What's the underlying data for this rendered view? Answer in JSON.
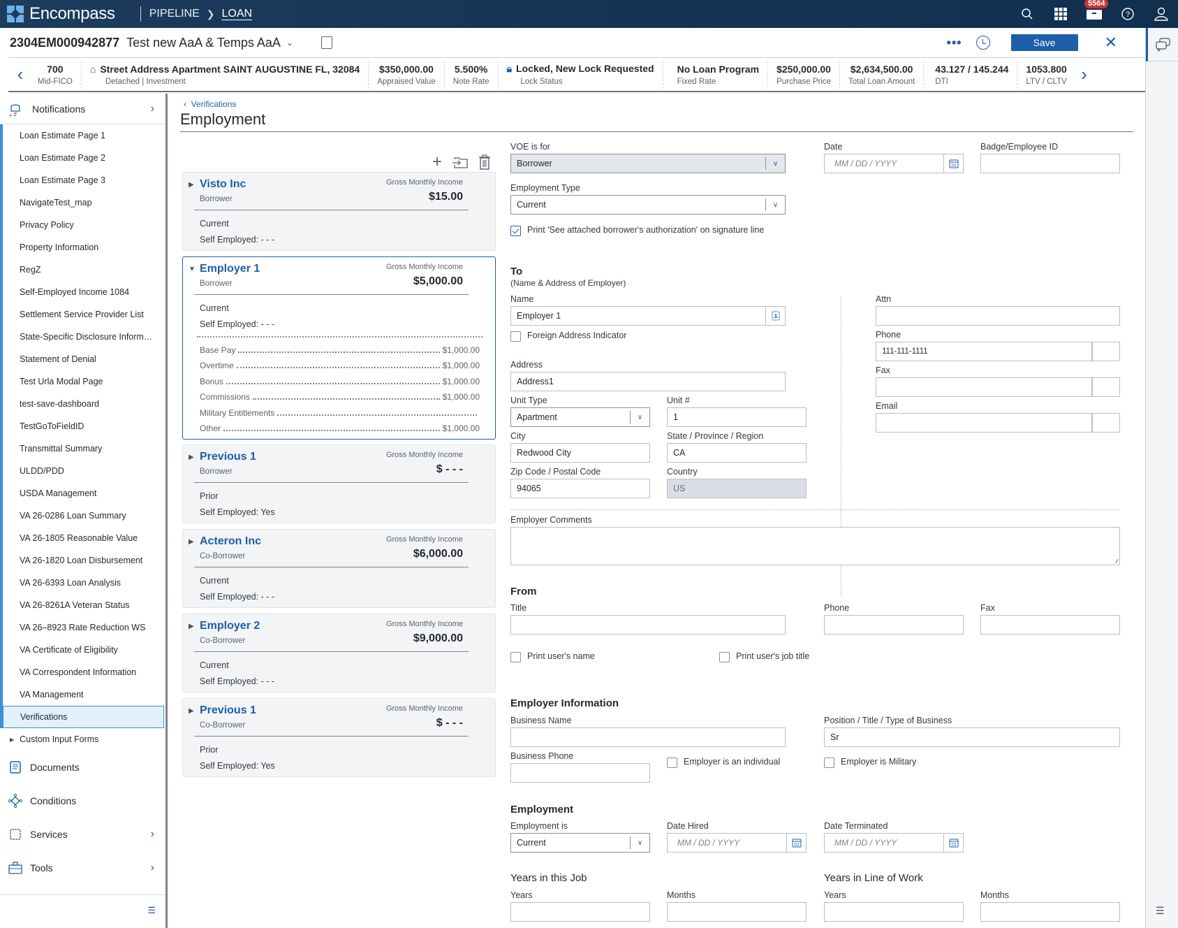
{
  "app": {
    "name": "Encompass",
    "breadcrumb": [
      "PIPELINE",
      "LOAN"
    ],
    "notification_count": "5564",
    "icons": [
      "search-icon",
      "apps-grid-icon",
      "inbox-icon",
      "help-icon",
      "user-icon"
    ]
  },
  "loan": {
    "number": "2304EM000942877",
    "borrower_name": "Test new AaA & Temps AaA",
    "save_label": "Save",
    "more_label": "•••"
  },
  "summary": [
    {
      "value": "700",
      "label": "Mid-FICO"
    },
    {
      "value": "Street Address Apartment SAINT AUGUSTINE FL, 32084",
      "label": "Detached | Investment",
      "icon": "home-icon"
    },
    {
      "value": "$350,000.00",
      "label": "Appraised Value"
    },
    {
      "value": "5.500%",
      "label": "Note Rate"
    },
    {
      "value": "Locked, New Lock Requested",
      "label": "Lock Status",
      "icon": "lock-icon"
    },
    {
      "value": "No Loan Program",
      "label": "Fixed Rate"
    },
    {
      "value": "$250,000.00",
      "label": "Purchase Price"
    },
    {
      "value": "$2,634,500.00",
      "label": "Total Loan Amount"
    },
    {
      "value": "43.127 / 145.244",
      "label": "DTI"
    },
    {
      "value": "1053.800",
      "label": "LTV / CLTV"
    }
  ],
  "sidebar": {
    "notifications": "Notifications",
    "forms": [
      "Loan Estimate Page 1",
      "Loan Estimate Page 2",
      "Loan Estimate Page 3",
      "NavigateTest_map",
      "Privacy Policy",
      "Property Information",
      "RegZ",
      "Self-Employed Income 1084",
      "Settlement Service Provider List",
      "State-Specific Disclosure Inform…",
      "Statement of Denial",
      "Test Urla Modal Page",
      "test-save-dashboard",
      "TestGoToFieldID",
      "Transmittal Summary",
      "ULDD/PDD",
      "USDA Management",
      "VA 26-0286 Loan Summary",
      "VA 26-1805 Reasonable Value",
      "VA 26-1820 Loan Disbursement",
      "VA 26-6393 Loan Analysis",
      "VA 26-8261A Veteran Status",
      "VA 26–8923 Rate Reduction WS",
      "VA Certificate of Eligibility",
      "VA Correspondent Information",
      "VA Management",
      "Verifications"
    ],
    "active_form": "Verifications",
    "custom_forms": "Custom Input Forms",
    "sections": [
      "Documents",
      "Conditions",
      "Services",
      "Tools"
    ]
  },
  "page": {
    "back_label": "Verifications",
    "title": "Employment"
  },
  "employers": [
    {
      "name": "Visto Inc",
      "role": "Borrower",
      "gmi_label": "Gross Monthly Income",
      "gmi": "$15.00",
      "status": "Current",
      "self_employed": "Self Employed: - - -",
      "expanded": false
    },
    {
      "name": "Employer 1",
      "role": "Borrower",
      "gmi_label": "Gross Monthly Income",
      "gmi": "$5,000.00",
      "status": "Current",
      "self_employed": "Self Employed: - - -",
      "expanded": true,
      "income": [
        {
          "label": "Base Pay",
          "value": "$1,000.00"
        },
        {
          "label": "Overtime",
          "value": "$1,000.00"
        },
        {
          "label": "Bonus",
          "value": "$1,000.00"
        },
        {
          "label": "Commissions",
          "value": "$1,000.00"
        },
        {
          "label": "Military Entitlements",
          "value": ""
        },
        {
          "label": "Other",
          "value": "$1,000.00"
        }
      ]
    },
    {
      "name": "Previous 1",
      "role": "Borrower",
      "gmi_label": "Gross Monthly Income",
      "gmi": "$ - - -",
      "status": "Prior",
      "self_employed": "Self Employed: Yes",
      "expanded": false
    },
    {
      "name": "Acteron Inc",
      "role": "Co-Borrower",
      "gmi_label": "Gross Monthly Income",
      "gmi": "$6,000.00",
      "status": "Current",
      "self_employed": "Self Employed: - - -",
      "expanded": false
    },
    {
      "name": "Employer 2",
      "role": "Co-Borrower",
      "gmi_label": "Gross Monthly Income",
      "gmi": "$9,000.00",
      "status": "Current",
      "self_employed": "Self Employed: - - -",
      "expanded": false
    },
    {
      "name": "Previous 1",
      "role": "Co-Borrower",
      "gmi_label": "Gross Monthly Income",
      "gmi": "$ - - -",
      "status": "Prior",
      "self_employed": "Self Employed: Yes",
      "expanded": false
    }
  ],
  "form": {
    "voe_for": {
      "label": "VOE is for",
      "value": "Borrower"
    },
    "date": {
      "label": "Date",
      "placeholder": "MM / DD / YYYY"
    },
    "badge": {
      "label": "Badge/Employee ID",
      "value": ""
    },
    "employment_type": {
      "label": "Employment Type",
      "value": "Current"
    },
    "print_auth": {
      "label": "Print 'See attached borrower's authorization' on signature line",
      "checked": true
    },
    "to": {
      "title": "To",
      "subtitle": "(Name & Address of Employer)",
      "name": {
        "label": "Name",
        "value": "Employer 1"
      },
      "foreign": {
        "label": "Foreign Address Indicator",
        "checked": false
      },
      "address": {
        "label": "Address",
        "value": "Address1"
      },
      "unit_type": {
        "label": "Unit Type",
        "value": "Apartment"
      },
      "unit_no": {
        "label": "Unit #",
        "value": "1"
      },
      "city": {
        "label": "City",
        "value": "Redwood City"
      },
      "state": {
        "label": "State / Province / Region",
        "value": "CA"
      },
      "zip": {
        "label": "Zip Code / Postal Code",
        "value": "94065"
      },
      "country": {
        "label": "Country",
        "value": "US"
      },
      "attn": {
        "label": "Attn",
        "value": ""
      },
      "phone": {
        "label": "Phone",
        "value": "111-111-1111"
      },
      "fax": {
        "label": "Fax",
        "value": ""
      },
      "email": {
        "label": "Email",
        "value": ""
      }
    },
    "comments": {
      "label": "Employer Comments",
      "value": ""
    },
    "from": {
      "title": "From",
      "title_field": {
        "label": "Title",
        "value": ""
      },
      "phone": {
        "label": "Phone",
        "value": ""
      },
      "fax": {
        "label": "Fax",
        "value": ""
      },
      "print_name": {
        "label": "Print user's name",
        "checked": false
      },
      "print_title": {
        "label": "Print user's job title",
        "checked": false
      }
    },
    "employer_info": {
      "title": "Employer Information",
      "business_name": {
        "label": "Business Name",
        "value": ""
      },
      "position": {
        "label": "Position / Title / Type of Business",
        "value": "Sr"
      },
      "business_phone": {
        "label": "Business Phone",
        "value": ""
      },
      "individual": {
        "label": "Employer is an individual",
        "checked": false
      },
      "military": {
        "label": "Employer is Military",
        "checked": false
      }
    },
    "employment": {
      "title": "Employment",
      "employment_is": {
        "label": "Employment is",
        "value": "Current"
      },
      "date_hired": {
        "label": "Date Hired",
        "placeholder": "MM / DD / YYYY"
      },
      "date_terminated": {
        "label": "Date Terminated",
        "placeholder": "MM / DD / YYYY"
      }
    },
    "years_job": {
      "title": "Years in this Job",
      "years": "Years",
      "months": "Months"
    },
    "years_line": {
      "title": "Years in Line of Work",
      "years": "Years",
      "months": "Months"
    }
  }
}
